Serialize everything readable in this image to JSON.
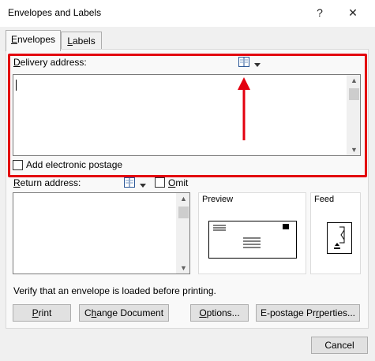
{
  "window": {
    "title": "Envelopes and Labels",
    "help_label": "?",
    "close_label": "✕"
  },
  "tabs": [
    {
      "label": "Envelopes",
      "accel": "E",
      "active": true
    },
    {
      "label": "Labels",
      "accel": "L",
      "active": false
    }
  ],
  "delivery": {
    "label_accel": "D",
    "label_rest": "elivery address:",
    "value": ""
  },
  "postage": {
    "label": "Add electronic postage",
    "checked": false
  },
  "return": {
    "label_accel": "R",
    "label_rest": "eturn address:",
    "value": "",
    "omit_label": "Omit",
    "omit_checked": false
  },
  "preview": {
    "label": "Preview"
  },
  "feed": {
    "label": "Feed"
  },
  "notice": "Verify that an envelope is loaded before printing.",
  "buttons": {
    "print": "Print",
    "change_document": "Change Document",
    "options": "Options...",
    "epostage": "E-postage Properties...",
    "cancel": "Cancel"
  },
  "icons": {
    "address_book": "address-book-icon",
    "dropdown": "chevron-down-icon",
    "annotation_arrow": "red-arrow-up"
  },
  "colors": {
    "highlight": "#e3000f",
    "dialog_bg": "#f0f0f0",
    "button_bg": "#e1e1e1"
  }
}
